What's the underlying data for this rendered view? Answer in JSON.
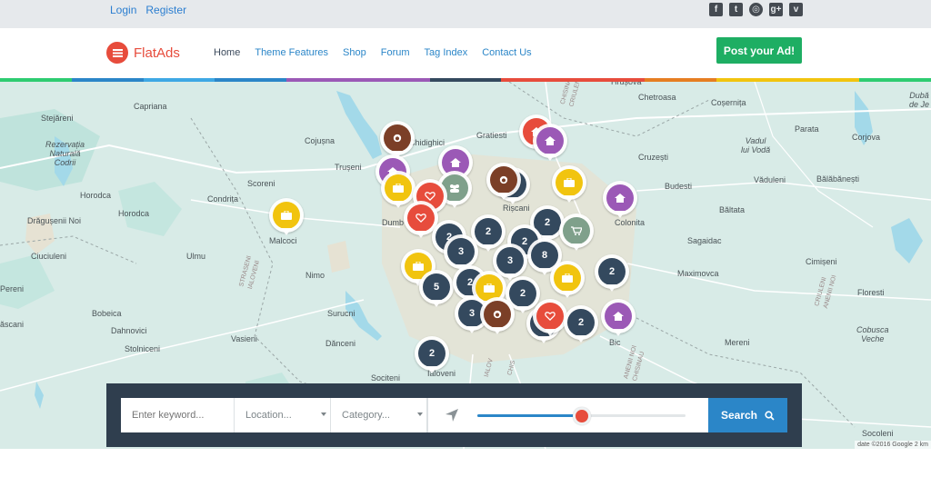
{
  "topbar": {
    "login": "Login",
    "register": "Register",
    "social": [
      {
        "icon": "facebook-icon",
        "glyph": "f"
      },
      {
        "icon": "twitter-icon",
        "glyph": "t"
      },
      {
        "icon": "dribbble-icon",
        "glyph": "◎"
      },
      {
        "icon": "google-plus-icon",
        "glyph": "g+"
      },
      {
        "icon": "vimeo-icon",
        "glyph": "v"
      }
    ]
  },
  "header": {
    "brand": "FlatAds",
    "nav": [
      "Home",
      "Theme Features",
      "Shop",
      "Forum",
      "Tag Index",
      "Contact Us"
    ],
    "post_ad": "Post your Ad!"
  },
  "stripe_colors": [
    "#2ecc71",
    "#2b86c8",
    "#3ea8e4",
    "#2b86c8",
    "#9b59b6",
    "#9b59b6",
    "#34495e",
    "#e74c3c",
    "#e74c3c",
    "#e67e22",
    "#f1c40f",
    "#f1c40f",
    "#2ecc71"
  ],
  "map": {
    "labels": [
      {
        "name": "Capriana"
      },
      {
        "name": "Stejăreni"
      },
      {
        "name": "Rezervația\nNaturală\nCodrii"
      },
      {
        "name": "Cojușna"
      },
      {
        "name": "Trușeni"
      },
      {
        "name": "Horodca"
      },
      {
        "name": "Condrița"
      },
      {
        "name": "Scoreni"
      },
      {
        "name": "Drăgușenii Noi"
      },
      {
        "name": "Horodca"
      },
      {
        "name": "Ciuciuleni"
      },
      {
        "name": "Malcoci"
      },
      {
        "name": "Ulmu"
      },
      {
        "name": "Pereni"
      },
      {
        "name": "Bobeica"
      },
      {
        "name": "Dahnovici"
      },
      {
        "name": "Stolniceni"
      },
      {
        "name": "Vasieni"
      },
      {
        "name": "Dănceni"
      },
      {
        "name": "Sociteni"
      },
      {
        "name": "Ialoveni"
      },
      {
        "name": "Surucni"
      },
      {
        "name": "Nimo"
      },
      {
        "name": "Dumb"
      },
      {
        "name": "Chidighici"
      },
      {
        "name": "Gratiesti"
      },
      {
        "name": "Cruzești"
      },
      {
        "name": "Chetroasa"
      },
      {
        "name": "Coșernița"
      },
      {
        "name": "Parata"
      },
      {
        "name": "Vadul\nlui Vodă"
      },
      {
        "name": "Corjova"
      },
      {
        "name": "Budesti"
      },
      {
        "name": "Văduleni"
      },
      {
        "name": "Bălăbănești"
      },
      {
        "name": "Colonita"
      },
      {
        "name": "Băltata"
      },
      {
        "name": "Sagaidac"
      },
      {
        "name": "Maximovca"
      },
      {
        "name": "Cimișeni"
      },
      {
        "name": "Floresti"
      },
      {
        "name": "Cobusca\nVeche"
      },
      {
        "name": "Merenі"
      },
      {
        "name": "Socoleni"
      },
      {
        "name": "Bic"
      },
      {
        "name": "Dubă\nde Je"
      },
      {
        "name": "Hrușova"
      },
      {
        "name": "Rișcani"
      },
      {
        "name": "ăscani"
      }
    ],
    "road_labels": [
      "STRASENI\nIALOVENI",
      "CRIULENI\nANENII NOI",
      "ANENII NOI\nCHISINAU",
      "CHISINAU\nCRIULENI",
      "IALOV",
      "CHIS"
    ],
    "pins": [
      {
        "color": "brown",
        "icon": "github-icon"
      },
      {
        "color": "red",
        "icon": "house-icon"
      },
      {
        "color": "purple",
        "icon": "house-icon"
      },
      {
        "color": "purple",
        "icon": "house-icon"
      },
      {
        "color": "purple",
        "icon": "house-icon"
      },
      {
        "color": "green",
        "icon": "group-icon"
      },
      {
        "color": "navy",
        "text": "2"
      },
      {
        "color": "brown",
        "icon": "github-icon"
      },
      {
        "color": "yellow",
        "icon": "briefcase-icon"
      },
      {
        "color": "yellow",
        "icon": "briefcase-icon"
      },
      {
        "color": "red",
        "icon": "heart-icon"
      },
      {
        "color": "purple",
        "icon": "house-icon"
      },
      {
        "color": "yellow",
        "icon": "briefcase-icon"
      },
      {
        "color": "red",
        "icon": "heart-icon"
      },
      {
        "color": "navy",
        "text": "2"
      },
      {
        "color": "navy",
        "text": "2"
      },
      {
        "color": "green",
        "icon": "cart-icon"
      },
      {
        "color": "navy",
        "text": "2"
      },
      {
        "color": "navy",
        "text": "3"
      },
      {
        "color": "navy",
        "text": "2"
      },
      {
        "color": "navy",
        "text": "8"
      },
      {
        "color": "navy",
        "text": "3"
      },
      {
        "color": "yellow",
        "icon": "briefcase-icon"
      },
      {
        "color": "navy",
        "text": "2"
      },
      {
        "color": "yellow",
        "icon": "briefcase-icon"
      },
      {
        "color": "navy",
        "text": "5"
      },
      {
        "color": "navy",
        "text": "2"
      },
      {
        "color": "yellow",
        "icon": "briefcase-icon"
      },
      {
        "color": "navy",
        "text": "2"
      },
      {
        "color": "navy",
        "text": "3"
      },
      {
        "color": "brown",
        "icon": "github-icon"
      },
      {
        "color": "navy",
        "text": "2"
      },
      {
        "color": "red",
        "icon": "heart-icon"
      },
      {
        "color": "navy",
        "text": "2"
      },
      {
        "color": "purple",
        "icon": "house-icon"
      },
      {
        "color": "navy",
        "text": "2"
      }
    ],
    "attribution": "date ©2016 Google   2 km"
  },
  "search": {
    "keyword_placeholder": "Enter keyword...",
    "location_label": "Location...",
    "category_label": "Category...",
    "radius_fraction": 0.5,
    "button": "Search"
  }
}
